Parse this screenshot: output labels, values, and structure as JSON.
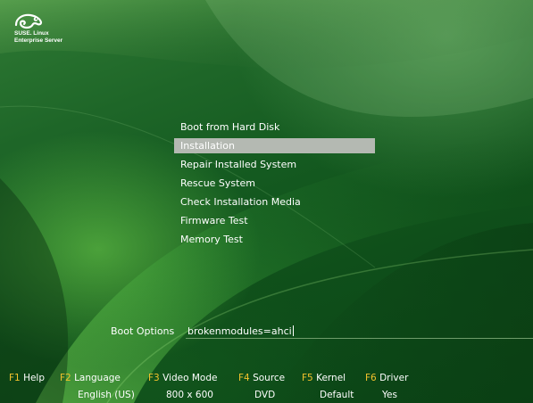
{
  "logo": {
    "icon": "suse-chameleon-icon",
    "line1": "SUSE. Linux",
    "line2": "Enterprise Server"
  },
  "menu": {
    "items": [
      {
        "label": "Boot from Hard Disk",
        "selected": false
      },
      {
        "label": "Installation",
        "selected": true
      },
      {
        "label": "Repair Installed System",
        "selected": false
      },
      {
        "label": "Rescue System",
        "selected": false
      },
      {
        "label": "Check Installation Media",
        "selected": false
      },
      {
        "label": "Firmware Test",
        "selected": false
      },
      {
        "label": "Memory Test",
        "selected": false
      }
    ]
  },
  "boot_options": {
    "label": "Boot Options",
    "value": "brokenmodules=ahci"
  },
  "fkeys": [
    {
      "key": "F1",
      "label": "Help",
      "value": ""
    },
    {
      "key": "F2",
      "label": "Language",
      "value": "English (US)"
    },
    {
      "key": "F3",
      "label": "Video Mode",
      "value": "800 x 600"
    },
    {
      "key": "F4",
      "label": "Source",
      "value": "DVD"
    },
    {
      "key": "F5",
      "label": "Kernel",
      "value": "Default"
    },
    {
      "key": "F6",
      "label": "Driver",
      "value": "Yes"
    }
  ],
  "colors": {
    "fkey_key": "#f3c22c",
    "selection": "#b4b9b2",
    "background": "#145a20"
  }
}
